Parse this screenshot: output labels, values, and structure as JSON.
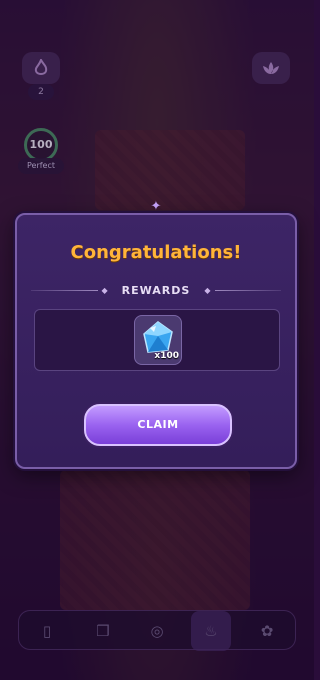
{
  "modal": {
    "title": "Congratulations!",
    "rewards_label": "REWARDS",
    "reward": {
      "icon": "blue-gem-icon",
      "quantity": "x100"
    },
    "claim_label": "CLAIM"
  },
  "hud": {
    "counter_value": "2",
    "score_value": "100",
    "score_label": "Perfect"
  },
  "bottom_nav": {
    "items": [
      {
        "icon": "card-icon"
      },
      {
        "icon": "cards-icon"
      },
      {
        "icon": "compass-icon"
      },
      {
        "icon": "flame-icon",
        "active": true
      },
      {
        "icon": "paw-icon"
      }
    ]
  },
  "colors": {
    "title": "#ffb43a",
    "button": "#9a63f0",
    "modal_bg": "#3d2566"
  }
}
